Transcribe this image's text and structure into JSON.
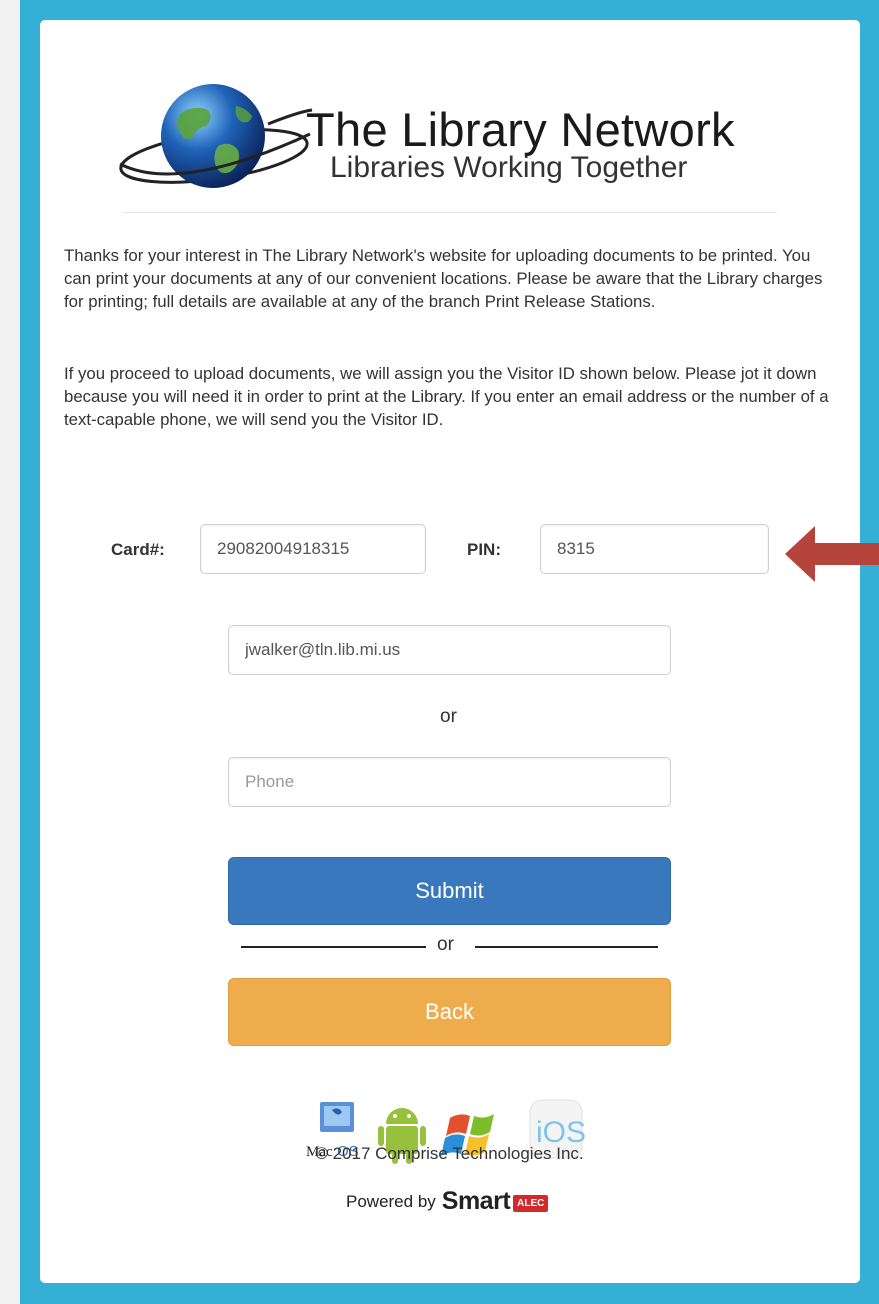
{
  "logo": {
    "title": "The Library Network",
    "tagline": "Libraries Working Together"
  },
  "intro": {
    "paragraph1": "Thanks for your interest in The Library Network's website for uploading documents to be printed. You can print your documents at any of our convenient locations. Please be aware that the Library charges for printing; full details are available at any of the branch Print Release Stations.",
    "paragraph2": "If you proceed to upload documents, we will assign you the Visitor ID shown below. Please jot it down because you will need it in order to print at the Library. If you enter an email address or the number of a text-capable phone, we will send you the Visitor ID."
  },
  "form": {
    "card_label": "Card#:",
    "card_value": "29082004918315",
    "pin_label": "PIN:",
    "pin_value": "8315",
    "email_value": "jwalker@tln.lib.mi.us",
    "or_text": "or",
    "phone_placeholder": "Phone",
    "submit_label": "Submit",
    "separator_text": "or",
    "back_label": "Back"
  },
  "footer": {
    "os_icons": [
      "macos-icon",
      "android-icon",
      "windows-icon",
      "ios-icon"
    ],
    "macos_label_mac": "Mac",
    "macos_label_os": "OS",
    "ios_label": "iOS",
    "copyright": "© 2017 Comprise Technologies Inc.",
    "powered_by": "Powered by",
    "brand": "Smart",
    "brand_badge": "ALEC"
  },
  "colors": {
    "frame": "#35afd6",
    "submit": "#3a78bd",
    "back": "#eeac4c",
    "arrow": "#b5453c"
  }
}
